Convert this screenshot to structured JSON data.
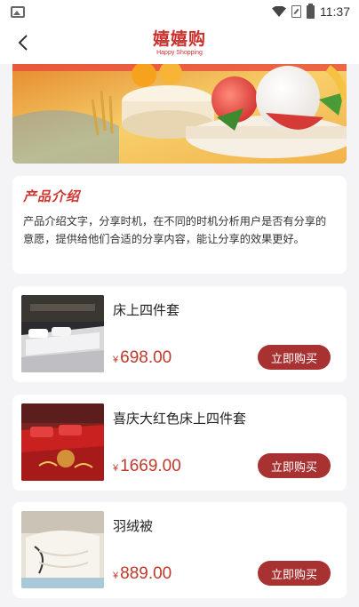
{
  "status_bar": {
    "time": "11:37"
  },
  "header": {
    "title": "嬉嬉购",
    "subtitle": "Happy Shopping"
  },
  "intro": {
    "title": "产品介绍",
    "text": "产品介绍文字，分享时机，在不同的时机分析用户是否有分享的意愿，提供给他们合适的分享内容，能让分享的效果更好。"
  },
  "products": [
    {
      "name": "床上四件套",
      "currency": "¥",
      "price": "698.00",
      "buy_label": "立即购买"
    },
    {
      "name": "喜庆大红色床上四件套",
      "currency": "¥",
      "price": "1669.00",
      "buy_label": "立即购买"
    },
    {
      "name": "羽绒被",
      "currency": "¥",
      "price": "889.00",
      "buy_label": "立即购买"
    }
  ],
  "colors": {
    "accent": "#c9302c",
    "buy_button": "#a83232",
    "price": "#c0392b"
  }
}
